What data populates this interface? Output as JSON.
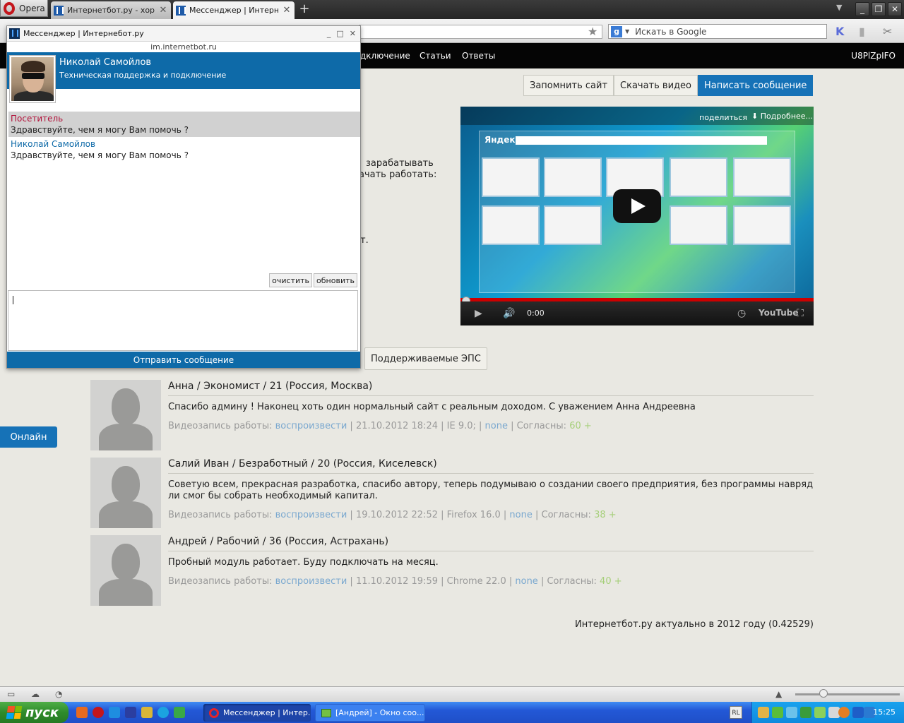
{
  "browser": {
    "menu_label": "Opera",
    "tabs": [
      {
        "title": "Интернетбот.ру - хорош..."
      },
      {
        "title": "Мессенджер | Интернеб..."
      }
    ],
    "search_placeholder": "Искать в Google",
    "new_tab_glyph": "+",
    "close_glyph": "✕"
  },
  "site": {
    "nav": [
      "дключение",
      "Статьи",
      "Ответы"
    ],
    "user": "U8PlZpIFO",
    "actions": {
      "remember": "Запомнить сайт",
      "download": "Скачать видео",
      "write": "Написать сообщение"
    },
    "bg_text": {
      "line1": "зарабатывать",
      "line2": "ачать работать:",
      "line3": "т."
    },
    "video": {
      "share": "поделиться",
      "more": "Подробнее...",
      "time": "0:00",
      "yandex": "Яндекс",
      "youtube": "YouTube"
    },
    "eps_tab": "Поддерживаемые ЭПС",
    "online": "Онлайн",
    "reviews": [
      {
        "author": "Анна / Экономист / 21 (Россия, Москва)",
        "text": "Спасибо админу ! Наконец хоть один нормальный сайт с реальным доходом. С уважением Анна Андреевна",
        "meta_label": "Видеозапись работы:",
        "play": "воспроизвести",
        "date": "21.10.2012 18:24",
        "browser": "IE 9.0;",
        "extra": "none",
        "agree_label": "Согласны:",
        "votes": "60 +"
      },
      {
        "author": "Салий Иван / Безработный / 20 (Россия, Киселевск)",
        "text": "Советую всем, прекрасная разработка, спасибо автору, теперь подумываю о создании своего предприятия, без программы навряд ли смог бы собрать необходимый капитал.",
        "meta_label": "Видеозапись работы:",
        "play": "воспроизвести",
        "date": "19.10.2012 22:52",
        "browser": "Firefox 16.0",
        "extra": "none",
        "agree_label": "Согласны:",
        "votes": "38 +"
      },
      {
        "author": "Андрей / Рабочий / 36 (Россия, Астрахань)",
        "text": "Пробный модуль работает. Буду подключать на месяц.",
        "meta_label": "Видеозапись работы:",
        "play": "воспроизвести",
        "date": "11.10.2012 19:59",
        "browser": "Chrome 22.0",
        "extra": "none",
        "agree_label": "Согласны:",
        "votes": "40 +"
      }
    ],
    "footer": "Интернетбот.ру актуально в 2012 году (0.42529)"
  },
  "messenger": {
    "window_title": "Мессенджер | Интернебот.ру",
    "host": "im.internetbot.ru",
    "agent_name": "Николай Самойлов",
    "agent_role": "Техническая поддержка и подключение",
    "messages": [
      {
        "from": "Посетитель",
        "text": "Здравствуйте, чем я могу Вам помочь ?"
      },
      {
        "from": "Николай Самойлов",
        "text": "Здравствуйте, чем я могу Вам помочь ?"
      }
    ],
    "clear": "очистить",
    "refresh": "обновить",
    "input_value": "",
    "send": "Отправить сообщение"
  },
  "taskbar": {
    "start": "пуск",
    "tasks": [
      {
        "title": "Мессенджер | Интер..."
      },
      {
        "title": "[Андрей] - Окно соо..."
      }
    ],
    "lang": "RL",
    "clock": "15:25"
  },
  "colors": {
    "accent": "#1672b7",
    "messenger_blue": "#0e6aa8",
    "visitor_name": "#b3123a",
    "link": "#7aa8cf",
    "votes": "#a6cf7a"
  }
}
